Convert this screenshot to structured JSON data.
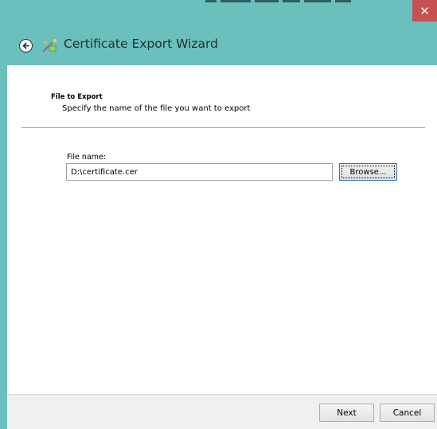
{
  "window": {
    "title": "Certificate Export Wizard",
    "close_symbol": "✕"
  },
  "icons": {
    "back": "back-arrow-circle-icon",
    "wizard": "certificate-wizard-icon",
    "close": "close-icon"
  },
  "colors": {
    "titlebar": "#6bbfbd",
    "close_button": "#c75050",
    "content_bg": "#ffffff",
    "footer_bg": "#f0f0f0"
  },
  "section": {
    "heading": "File to Export",
    "description": "Specify the name of the file you want to export"
  },
  "file_field": {
    "label": "File name:",
    "value": "D:\\certificate.cer",
    "placeholder": ""
  },
  "buttons": {
    "browse": "Browse...",
    "next": "Next",
    "cancel": "Cancel"
  }
}
